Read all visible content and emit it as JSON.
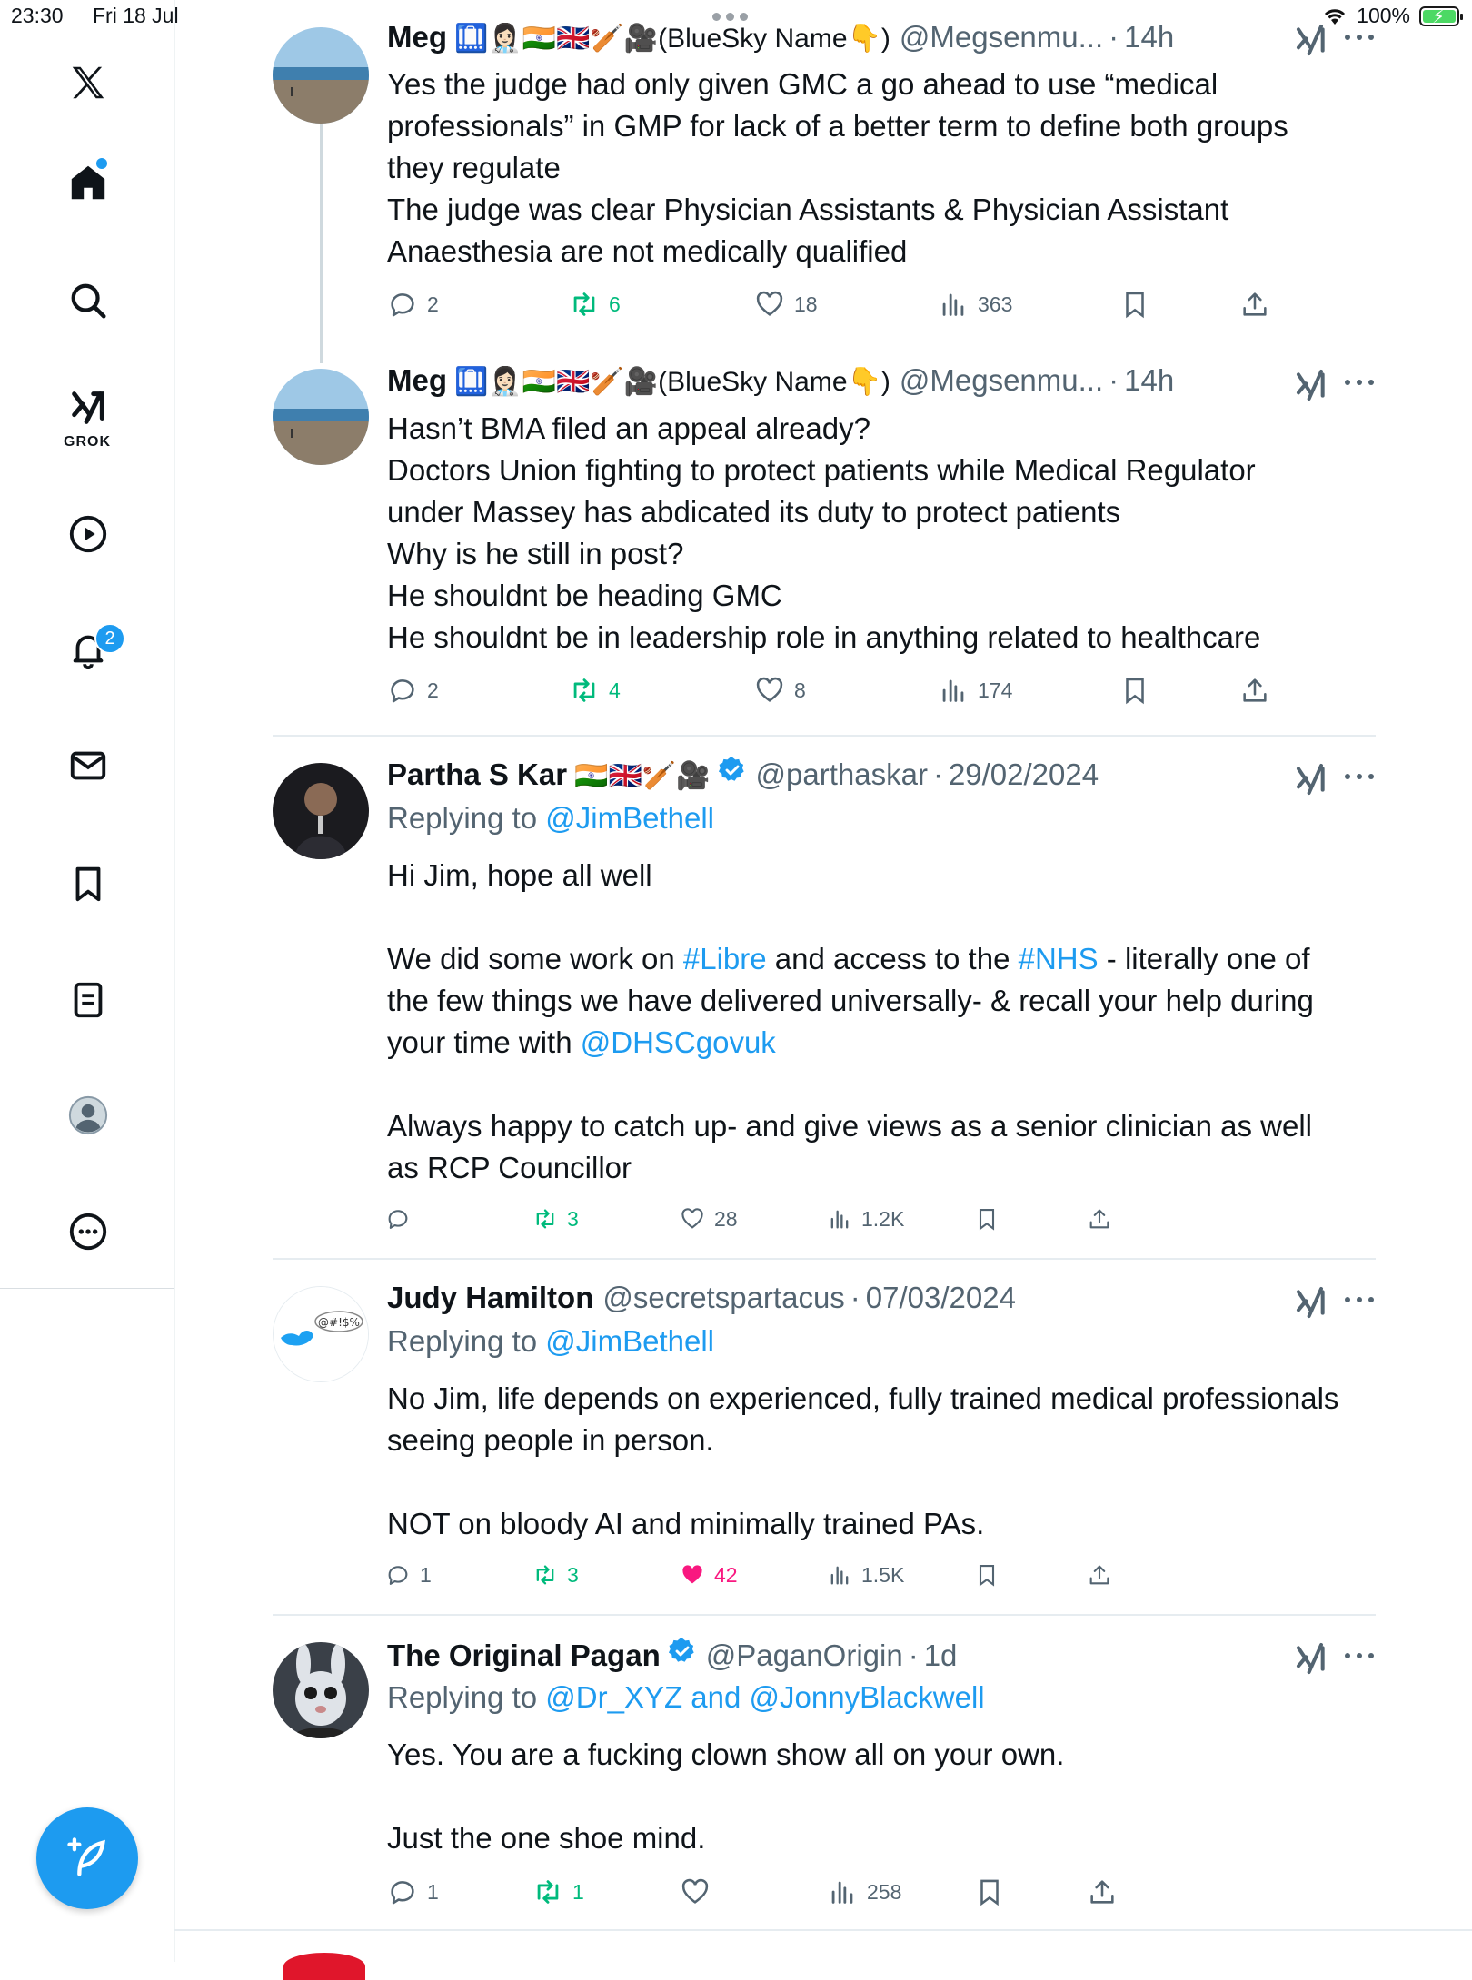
{
  "status_bar": {
    "time": "23:30",
    "date": "Fri 18 Jul",
    "battery": "100%"
  },
  "sidebar": {
    "items": [
      {
        "name": "x-logo-icon"
      },
      {
        "name": "home-icon"
      },
      {
        "name": "search-icon"
      },
      {
        "name": "grok-icon",
        "label": "GROK"
      },
      {
        "name": "video-icon"
      },
      {
        "name": "notifications-icon",
        "badge": "2"
      },
      {
        "name": "messages-icon"
      },
      {
        "name": "bookmarks-icon"
      },
      {
        "name": "lists-icon"
      },
      {
        "name": "profile-icon"
      },
      {
        "name": "more-icon"
      }
    ],
    "colors": {
      "accent": "#1d9bf0"
    }
  },
  "tweets": [
    {
      "name": "Meg",
      "emoji": "🛄👩🏻‍⚕️🇮🇳🇬🇧🏏🎥(BlueSky Name👇)",
      "handle": "@Megsenmu...",
      "time": "14h",
      "lines": [
        "Yes the judge had only given GMC a go ahead to use “medical",
        "professionals” in GMP for lack of a better term to define both groups",
        "they regulate",
        "The judge was clear Physician Assistants & Physician Assistant",
        "Anaesthesia are not medically qualified"
      ],
      "replies": "2",
      "reposts": "6",
      "likes": "18",
      "views": "363"
    },
    {
      "name": "Meg",
      "emoji": "🛄👩🏻‍⚕️🇮🇳🇬🇧🏏🎥(BlueSky Name👇)",
      "handle": "@Megsenmu...",
      "time": "14h",
      "lines": [
        "Hasn’t BMA filed an appeal already?",
        "Doctors Union fighting to protect patients while Medical Regulator",
        "under Massey has abdicated its duty to protect patients",
        "Why is he still in post?",
        "He shouldnt be heading GMC",
        "He shouldnt be in leadership role in anything related to healthcare"
      ],
      "replies": "2",
      "reposts": "4",
      "likes": "8",
      "views": "174"
    },
    {
      "name": "Partha S Kar",
      "emoji": "🇮🇳🇬🇧🏏🎥",
      "handle": "@parthaskar",
      "time": "29/02/2024",
      "replying_label": "Replying to",
      "replying_to": "@JimBethell",
      "text": {
        "l1": "Hi Jim, hope all well",
        "l2a": "We did some work on ",
        "tag1": "#Libre",
        "l2b": " and access to the ",
        "tag2": "#NHS",
        "l2c": " - literally one of",
        "l3": "the few things we have delivered universally- & recall your help during",
        "l4a": "your time with ",
        "mention": "@DHSCgovuk",
        "l5": "Always happy to catch up- and give views as a senior clinician as well",
        "l6": "as RCP Councillor"
      },
      "replies": "",
      "reposts": "3",
      "likes": "28",
      "views": "1.2K"
    },
    {
      "name": "Judy Hamilton",
      "handle": "@secretspartacus",
      "time": "07/03/2024",
      "avatar_text": "@#!$%",
      "replying_label": "Replying to",
      "replying_to": "@JimBethell",
      "lines": [
        "No Jim, life depends on experienced, fully trained medical professionals",
        "seeing people in person.",
        "",
        "NOT on bloody AI and minimally trained PAs."
      ],
      "replies": "1",
      "reposts": "3",
      "likes": "42",
      "views": "1.5K"
    },
    {
      "name": "The Original Pagan",
      "handle": "@PaganOrigin",
      "time": "1d",
      "replying_label": "Replying to",
      "replying_to": "@Dr_XYZ and @JonnyBlackwell",
      "lines": [
        "Yes. You are a fucking clown show all on your own.",
        "",
        "Just the one shoe mind."
      ],
      "replies": "1",
      "reposts": "1",
      "likes": "",
      "views": "258"
    }
  ]
}
